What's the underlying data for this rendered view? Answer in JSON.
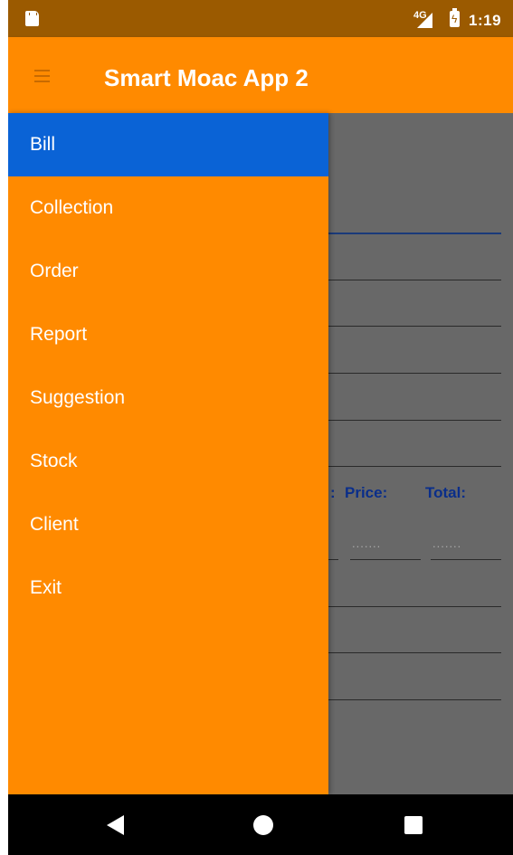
{
  "status_bar": {
    "network": "4G",
    "time": "1:19"
  },
  "app_bar": {
    "title": "Smart Moac App 2",
    "menu_icon": "hamburger-menu-icon"
  },
  "drawer": {
    "items": [
      {
        "label": "Bill",
        "selected": true
      },
      {
        "label": "Collection",
        "selected": false
      },
      {
        "label": "Order",
        "selected": false
      },
      {
        "label": "Report",
        "selected": false
      },
      {
        "label": "Suggestion",
        "selected": false
      },
      {
        "label": "Stock",
        "selected": false
      },
      {
        "label": "Client",
        "selected": false
      },
      {
        "label": "Exit",
        "selected": false
      }
    ]
  },
  "background_form": {
    "columns": {
      "partial": ":",
      "price": "Price:",
      "total": "Total:"
    },
    "price_placeholder": ".......",
    "total_placeholder": "......."
  },
  "nav_bar": {
    "back_icon": "back-triangle-icon",
    "home_icon": "home-circle-icon",
    "recents_icon": "recents-square-icon"
  },
  "colors": {
    "app_bar": "#ff8a00",
    "status_bar": "#9b5a00",
    "drawer": "#ff8a00",
    "selected_item": "#0a63d6",
    "scrim": "#686868",
    "column_label": "#0a2e8a"
  }
}
